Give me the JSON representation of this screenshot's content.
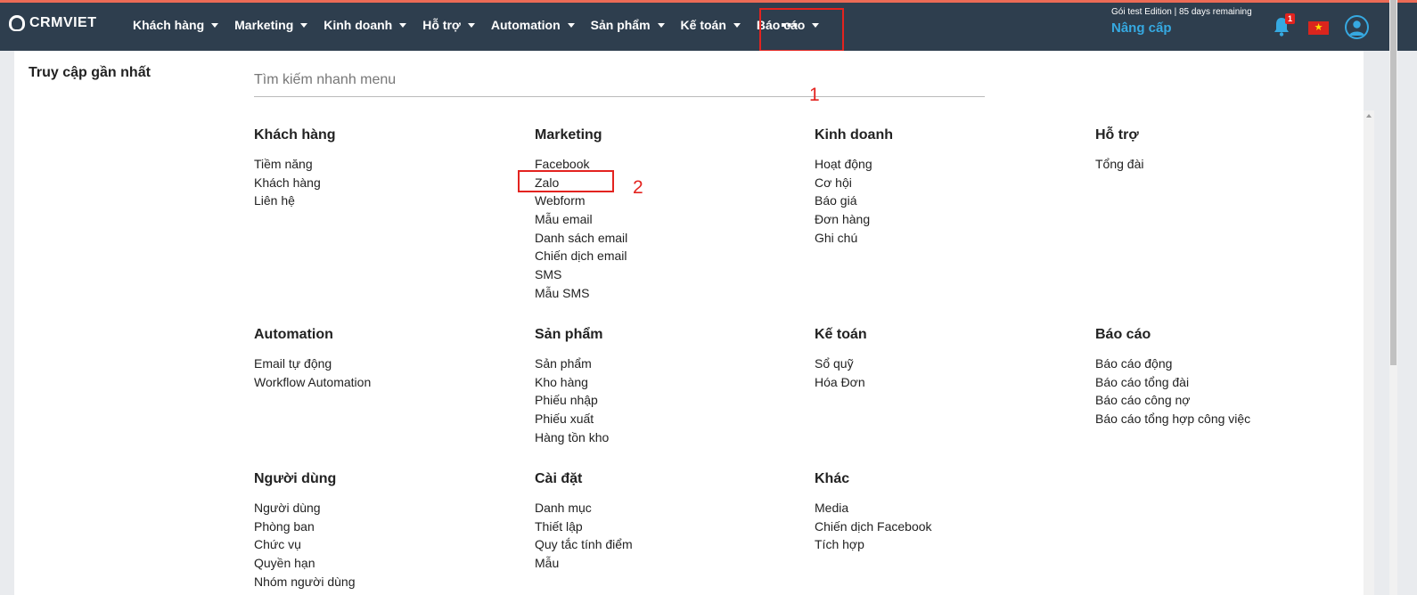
{
  "app": {
    "logo_text": "CRMVIET"
  },
  "nav": {
    "items": [
      {
        "label": "Khách hàng"
      },
      {
        "label": "Marketing"
      },
      {
        "label": "Kinh doanh"
      },
      {
        "label": "Hỗ trợ"
      },
      {
        "label": "Automation"
      },
      {
        "label": "Sản phẩm"
      },
      {
        "label": "Kế toán"
      },
      {
        "label": "Báo cáo"
      }
    ],
    "more_label": "▪▪▪"
  },
  "header_right": {
    "plan_text": "Gói test Edition | 85 days remaining",
    "upgrade_label": "Nâng cấp",
    "notification_count": "1",
    "flag_icon": "vietnam-flag-icon",
    "flag_star": "★"
  },
  "menu_panel": {
    "recent_title": "Truy cập gần nhất",
    "search_placeholder": "Tìm kiếm nhanh menu",
    "annotations": {
      "one": "1",
      "two": "2"
    },
    "sections": [
      {
        "title": "Khách hàng",
        "items": [
          "Tiềm năng",
          "Khách hàng",
          "Liên hệ"
        ]
      },
      {
        "title": "Marketing",
        "items": [
          "Facebook",
          "Zalo",
          "Webform",
          "Mẫu email",
          "Danh sách email",
          "Chiến dịch email",
          "SMS",
          "Mẫu SMS"
        ]
      },
      {
        "title": "Kinh doanh",
        "items": [
          "Hoạt động",
          "Cơ hội",
          "Báo giá",
          "Đơn hàng",
          "Ghi chú"
        ]
      },
      {
        "title": "Hỗ trợ",
        "items": [
          "Tổng đài"
        ]
      },
      {
        "title": "Automation",
        "items": [
          "Email tự động",
          "Workflow Automation"
        ]
      },
      {
        "title": "Sản phẩm",
        "items": [
          "Sản phẩm",
          "Kho hàng",
          "Phiếu nhập",
          "Phiếu xuất",
          "Hàng tồn kho"
        ]
      },
      {
        "title": "Kế toán",
        "items": [
          "Sổ quỹ",
          "Hóa Đơn"
        ]
      },
      {
        "title": "Báo cáo",
        "items": [
          "Báo cáo động",
          "Báo cáo tổng đài",
          "Báo cáo công nợ",
          "Báo cáo tổng hợp công việc"
        ]
      },
      {
        "title": "Người dùng",
        "items": [
          "Người dùng",
          "Phòng ban",
          "Chức vụ",
          "Quyền hạn",
          "Nhóm người dùng"
        ]
      },
      {
        "title": "Cài đặt",
        "items": [
          "Danh mục",
          "Thiết lập",
          "Quy tắc tính điểm",
          "Mẫu"
        ]
      },
      {
        "title": "Khác",
        "items": [
          "Media",
          "Chiến dịch Facebook",
          "Tích hợp"
        ]
      }
    ]
  },
  "colors": {
    "topbar": "#2e3e4e",
    "accent": "#36a9e1",
    "highlight": "#e3231f"
  }
}
